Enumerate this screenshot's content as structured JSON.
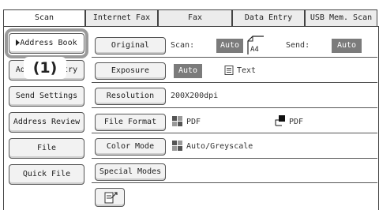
{
  "tabs": [
    "Scan",
    "Internet Fax",
    "Fax",
    "Data Entry",
    "USB Mem. Scan"
  ],
  "sidebar": {
    "items": [
      {
        "label": "Address Book"
      },
      {
        "label": "Address Entry"
      },
      {
        "label": "Send Settings"
      },
      {
        "label": "Address Review"
      },
      {
        "label": "File"
      },
      {
        "label": "Quick File"
      }
    ],
    "callout": "(1)"
  },
  "settings": {
    "original": {
      "button": "Original",
      "scan_label": "Scan:",
      "scan_value": "Auto",
      "paper": "A4",
      "send_label": "Send:",
      "send_value": "Auto"
    },
    "exposure": {
      "button": "Exposure",
      "mode": "Auto",
      "type": "Text"
    },
    "resolution": {
      "button": "Resolution",
      "value": "200X200dpi"
    },
    "file_format": {
      "button": "File Format",
      "format1": "PDF",
      "format2": "PDF"
    },
    "color_mode": {
      "button": "Color Mode",
      "value": "Auto/Greyscale"
    },
    "special_modes": {
      "button": "Special Modes"
    }
  },
  "icons": [
    "triangle-right-icon",
    "page-icon",
    "text-doc-icon",
    "grid-icon",
    "mono-icon",
    "preview-icon"
  ],
  "colors": {
    "badge": "#7b7b7b",
    "button": "#f2f2f2",
    "highlight": "#9a9a9a"
  }
}
